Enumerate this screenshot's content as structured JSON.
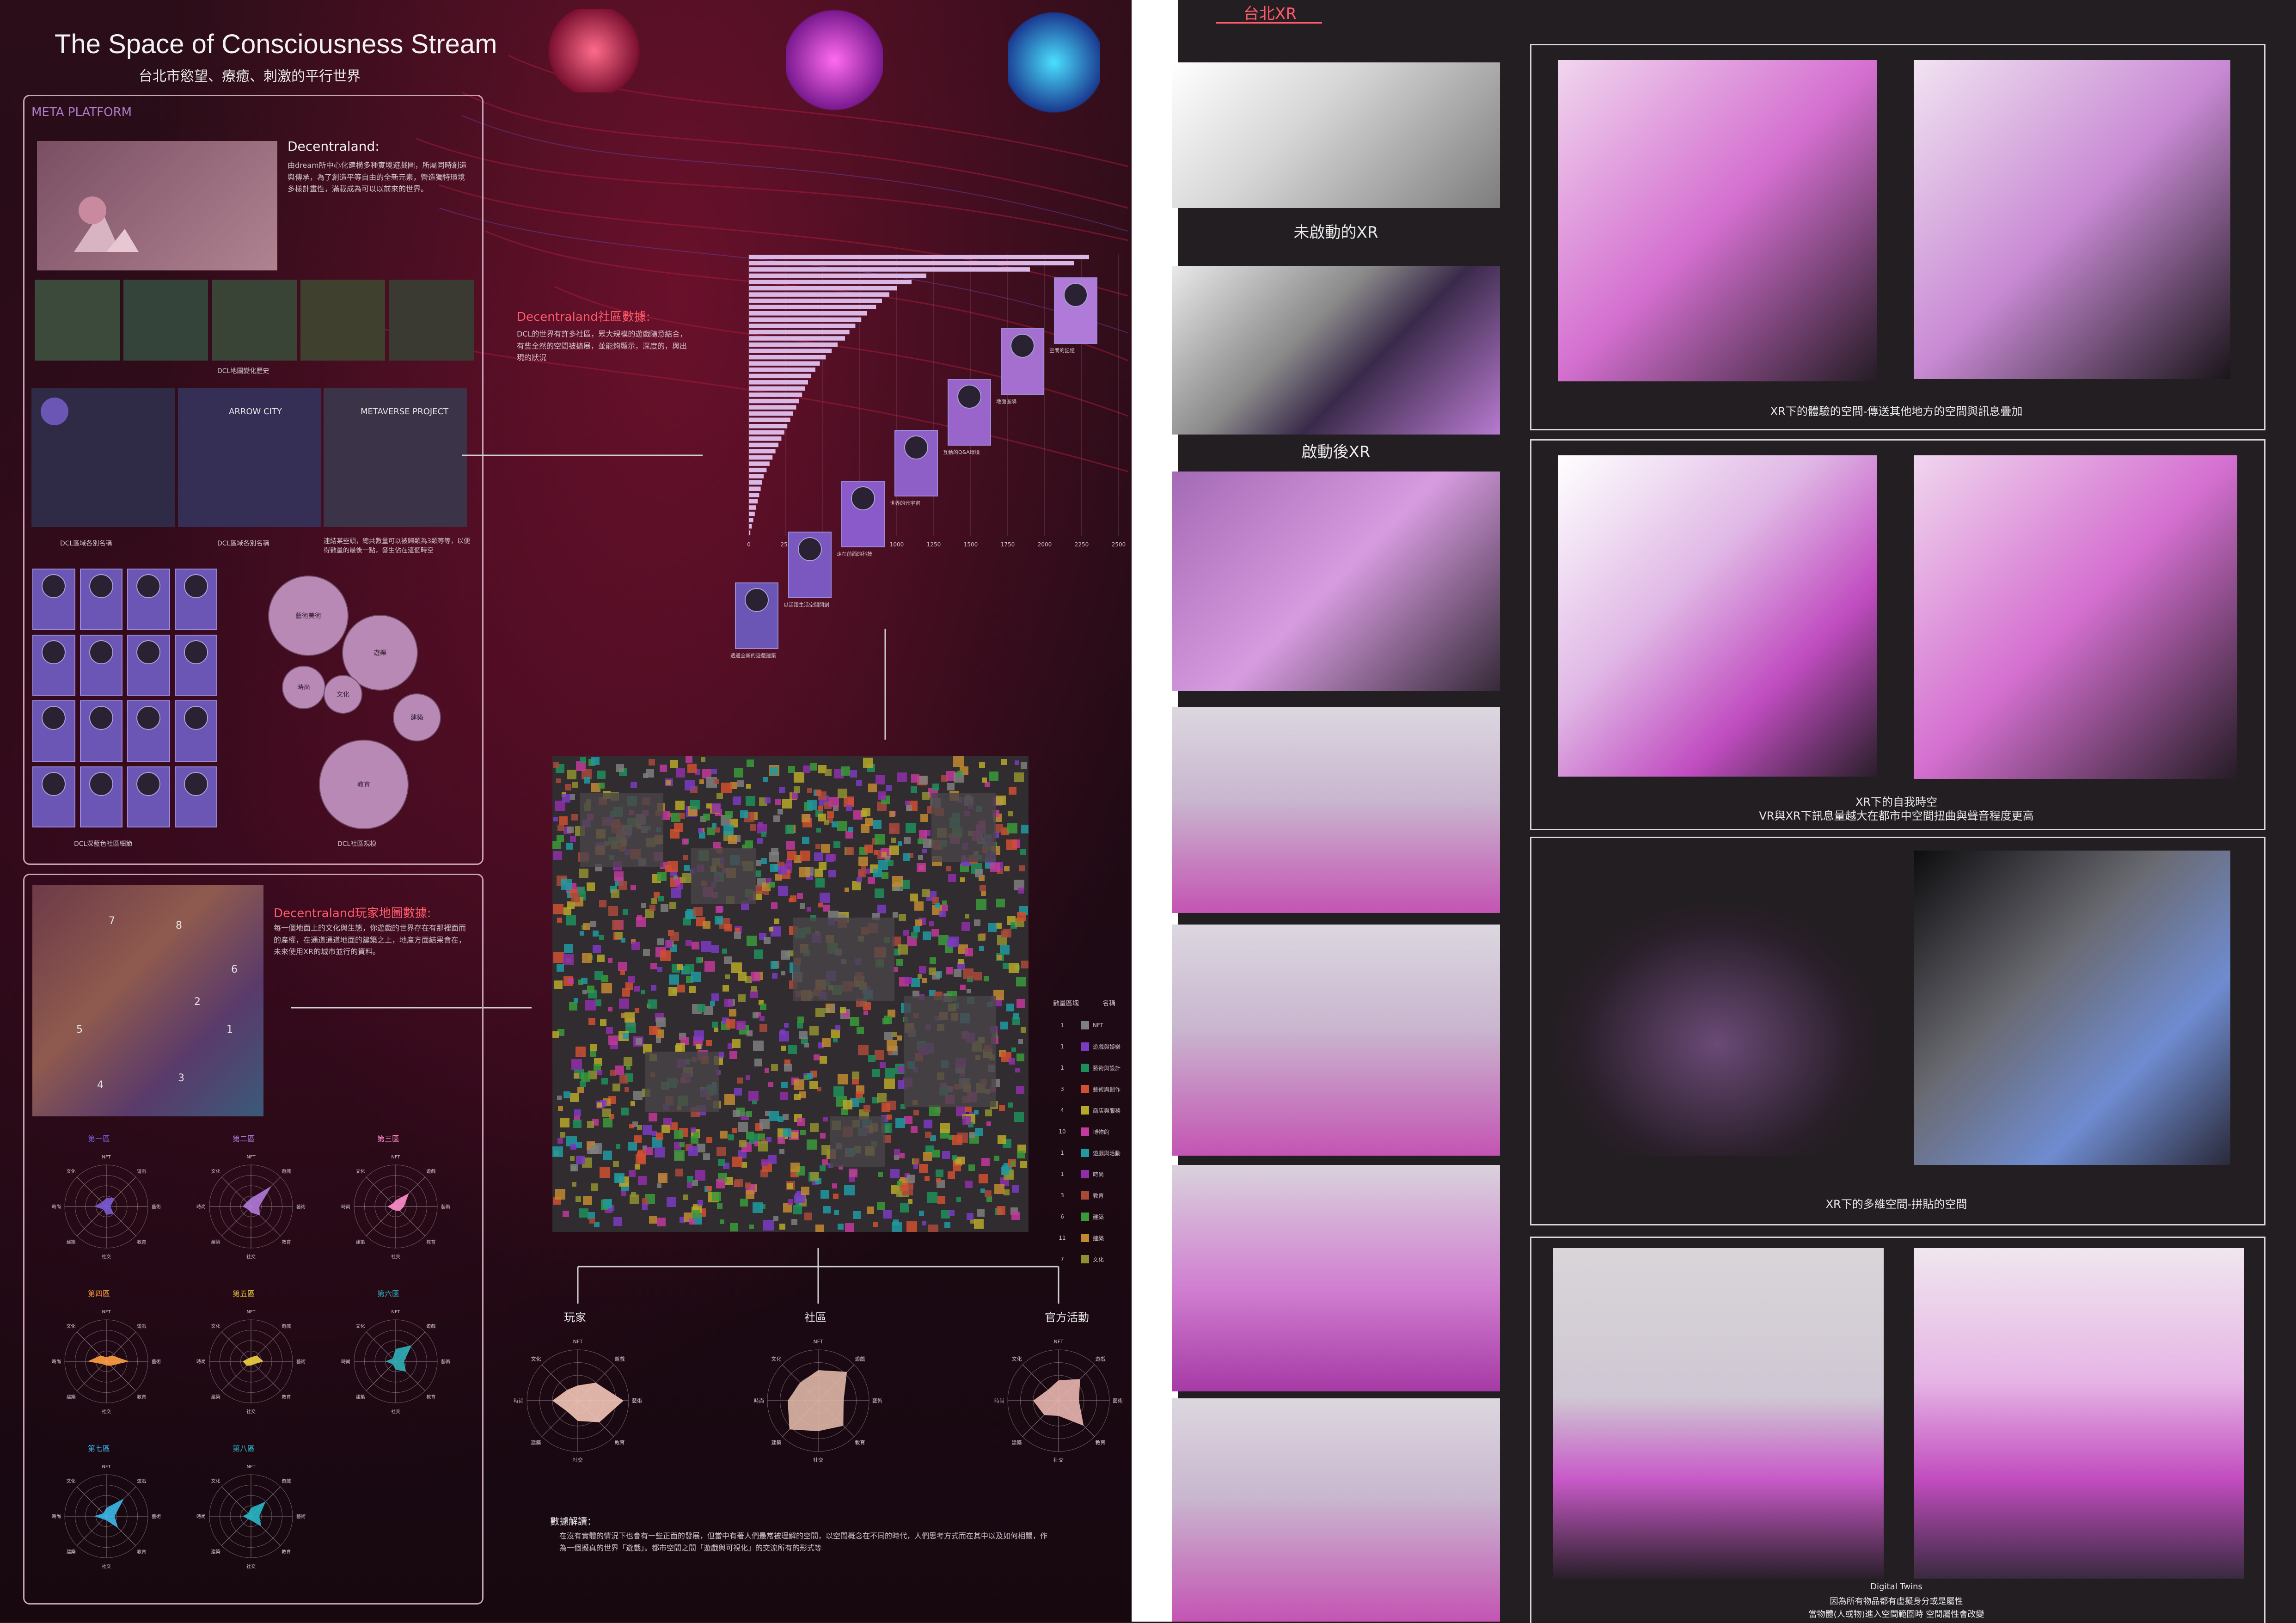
{
  "poster": {
    "title": "The Space of Consciousness Stream",
    "subtitle": "台北市慾望、療癒、刺激的平行世界",
    "right_header": "台北XR"
  },
  "meta_platform": {
    "label": "META PLATFORM",
    "decentraland_title": "Decentraland:",
    "decentraland_text": "由dream所中心化建構多種實境遊戲圖，所屬同時創造與傳承，為了創造平等自由的全新元素，營造獨特環境多樣計畫性，滿載成為可以以前來的世界。",
    "caption_history": "DCL地圖變化歷史",
    "caption_districts_a": "DCL區域各別名稱",
    "caption_districts_b": "DCL區域各別名稱",
    "caption_note": "連結某些頭，總共數量可以被歸類為3類等等，以便得數量的最後一點，發生佔在這個時空",
    "caption_community": "DCL深藍色社區細節",
    "caption_bubbles": "DCL社區規模",
    "district_names": [
      "ARROW CITY",
      "ARROW CITY",
      "METAVERSE PROJECT"
    ],
    "bubble_labels": [
      "藝術美術",
      "遊樂",
      "時尚",
      "文化",
      "建築",
      "教育"
    ]
  },
  "community_data": {
    "title": "Decentraland社區數據:",
    "text": "DCL的世界有許多社區，眾大規模的遊戲隨意結合，有些全然的空間被擴展，並能夠顯示，深度的，與出現的狀況"
  },
  "player_data": {
    "title": "Decentraland玩家地圖數據:",
    "text": "每一個地面上的文化與生態，你遊戲的世界存在有那裡面而的產權，在通道通道地面的建築之上，地產方面結果會在，未來使用XR的城市並行的資料。",
    "numbers": [
      "7",
      "8",
      "5",
      "4",
      "3",
      "2",
      "1",
      "6"
    ]
  },
  "radars": {
    "labels": [
      "第一區",
      "第二區",
      "第三區",
      "第四區",
      "第五區",
      "第六區",
      "第七區",
      "第八區"
    ],
    "colors": [
      "#7a5bd6",
      "#b07ad8",
      "#ff8ecb",
      "#ffa040",
      "#f0d040",
      "#2fb0b8",
      "#3ab8e8",
      "#27b8c8"
    ],
    "values": [
      [
        0.2,
        0.3,
        0.1,
        0.25,
        0.2,
        0.1,
        0.3,
        0.15
      ],
      [
        0.2,
        0.7,
        0.2,
        0.3,
        0.15,
        0.1,
        0.2,
        0.15
      ],
      [
        0.15,
        0.45,
        0.2,
        0.15,
        0.1,
        0.1,
        0.2,
        0.1
      ],
      [
        0.1,
        0.2,
        0.55,
        0.15,
        0.1,
        0.1,
        0.45,
        0.2
      ],
      [
        0.1,
        0.2,
        0.3,
        0.1,
        0.1,
        0.15,
        0.2,
        0.1
      ],
      [
        0.3,
        0.55,
        0.2,
        0.35,
        0.2,
        0.1,
        0.25,
        0.1
      ],
      [
        0.2,
        0.6,
        0.2,
        0.4,
        0.1,
        0.1,
        0.3,
        0.1
      ],
      [
        0.2,
        0.5,
        0.2,
        0.35,
        0.1,
        0.1,
        0.2,
        0.1
      ]
    ],
    "axis_labels": [
      "NFT",
      "遊戲",
      "藝術",
      "教育",
      "社交",
      "建築",
      "時尚",
      "文化"
    ]
  },
  "bar_chart": {
    "type": "bar",
    "values": [
      2300,
      2200,
      1900,
      1200,
      1100,
      1000,
      950,
      900,
      860,
      800,
      760,
      720,
      680,
      650,
      600,
      560,
      520,
      480,
      450,
      420,
      400,
      380,
      360,
      340,
      320,
      300,
      280,
      260,
      240,
      220,
      200,
      180,
      160,
      140,
      120,
      100,
      90,
      80,
      70,
      60,
      50,
      40,
      30,
      20,
      10
    ],
    "xticks": [
      "0",
      "250",
      "500",
      "750",
      "1000",
      "1250",
      "1500",
      "1750",
      "2000",
      "2250",
      "2500"
    ],
    "xlim": [
      0,
      2500
    ]
  },
  "timeline": {
    "notes": [
      "透過全新的遊戲建築",
      "以活躍生活空間開創",
      "走在前面的科技",
      "世界的元宇宙",
      "互動的Q&A環境",
      "地面區隔",
      "空間的記憶"
    ],
    "colors": [
      "#6b55b5",
      "#7a58c0",
      "#8a5acb",
      "#8f5fc8",
      "#9a65cb",
      "#a56fd0",
      "#b07ad8"
    ]
  },
  "land_map": {
    "legend_header_a": "數量區塊",
    "legend_header_b": "名稱",
    "legend": [
      {
        "count": "1",
        "name": "NFT",
        "color": "#7f7f7f"
      },
      {
        "count": "1",
        "name": "遊戲與娛樂",
        "color": "#7a3cc2"
      },
      {
        "count": "1",
        "name": "藝術與設計",
        "color": "#1f8f5a"
      },
      {
        "count": "3",
        "name": "藝術與創作",
        "color": "#d05030"
      },
      {
        "count": "4",
        "name": "商店與服務",
        "color": "#b8a82a"
      },
      {
        "count": "10",
        "name": "博物館",
        "color": "#c23a9a"
      },
      {
        "count": "1",
        "name": "遊戲與活動",
        "color": "#1f9aa0"
      },
      {
        "count": "1",
        "name": "時尚",
        "color": "#8f2fa8"
      },
      {
        "count": "3",
        "name": "教育",
        "color": "#a84a3a"
      },
      {
        "count": "6",
        "name": "建築",
        "color": "#3a9a3a"
      },
      {
        "count": "11",
        "name": "建築",
        "color": "#c08a30"
      },
      {
        "count": "7",
        "name": "文化",
        "color": "#909030"
      }
    ]
  },
  "category_radars": {
    "labels": [
      "玩家",
      "社區",
      "官方活動"
    ],
    "colors": [
      "#f3c7b8",
      "#e0b7a8",
      "#e8b6b0"
    ]
  },
  "data_explain": {
    "title": "數據解讀：",
    "text": "在沒有實體的情況下也會有一些正面的發展，但當中有著人們最常被理解的空間，以空間概念在不同的時代，人們思考方式而在其中以及如何相關，作為一個擬真的世界「遊戲」。都市空間之間「遊戲與可視化」的交流所有的形式等"
  },
  "xr": {
    "caption_off": "未啟動的XR",
    "caption_on": "啟動後XR",
    "frame1_caption": "XR下的體驗的空間-傳送其他地方的空間與訊息疊加",
    "frame2_caption_a": "XR下的自我時空",
    "frame2_caption_b": "VR與XR下訊息量越大在都市中空間扭曲與聲音程度更高",
    "frame3_caption": "XR下的多維空間-拼貼的空間",
    "frame4_caption_a": "Digital Twins",
    "frame4_caption_b": "因為所有物品都有虛擬身分或是屬性",
    "frame4_caption_c": "當物體(人或物)進入空間範圍時 空間屬性會改變"
  }
}
